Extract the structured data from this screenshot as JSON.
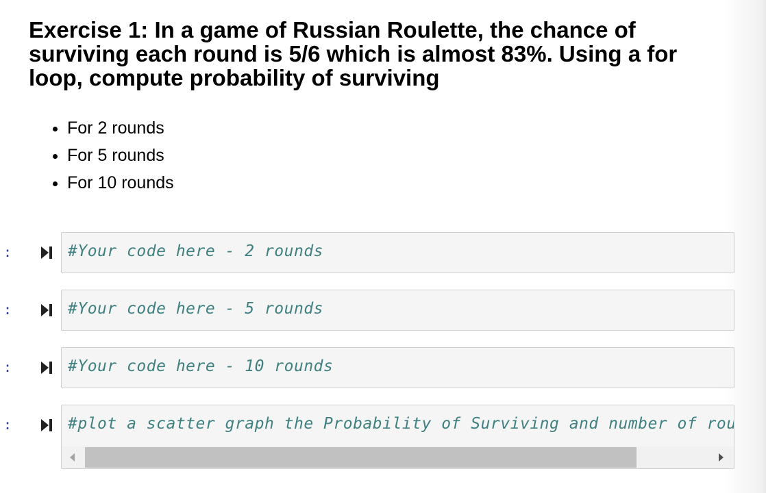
{
  "markdown": {
    "heading": "Exercise 1: In a game of Russian Roulette, the chance of surviving each round is 5/6 which is almost 83%. Using a for loop, compute probability of surviving",
    "bullets": [
      "For 2 rounds",
      "For 5 rounds",
      "For 10 rounds"
    ]
  },
  "cells": [
    {
      "prompt": ":",
      "code": "#Your code here - 2 rounds"
    },
    {
      "prompt": ":",
      "code": "#Your code here - 5 rounds"
    },
    {
      "prompt": ":",
      "code": "#Your code here - 10 rounds"
    },
    {
      "prompt": ":",
      "code": "#plot a scatter graph the Probability of Surviving and number of rounds"
    }
  ],
  "icons": {
    "run": "run-cell-icon"
  },
  "colors": {
    "prompt": "#303f9f",
    "comment": "#408080",
    "cell_bg": "#f5f5f5",
    "cell_border": "#cfcfcf"
  }
}
